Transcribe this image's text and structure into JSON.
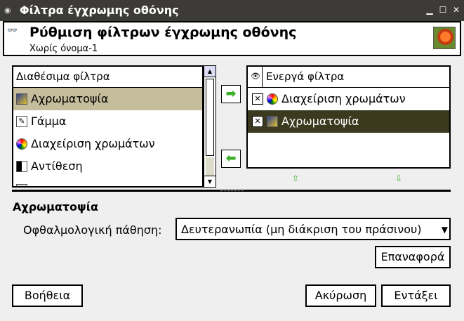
{
  "window": {
    "title": "Φίλτρα έγχρωμης οθόνης"
  },
  "header": {
    "title": "Ρύθμιση φίλτρων έγχρωμης οθόνης",
    "subtitle": "Χωρίς όνομα-1"
  },
  "available": {
    "heading": "Διαθέσιμα φίλτρα",
    "items": [
      {
        "label": "Αχρωματοψία",
        "icon": "color-filter-icon"
      },
      {
        "label": "Γάμμα",
        "icon": "gamma-icon"
      },
      {
        "label": "Διαχείριση χρωμάτων",
        "icon": "color-management-icon"
      },
      {
        "label": "Αντίθεση",
        "icon": "contrast-icon"
      }
    ]
  },
  "active": {
    "heading": "Ενεργά φίλτρα",
    "items": [
      {
        "label": "Διαχείριση χρωμάτων",
        "checked": true
      },
      {
        "label": "Αχρωματοψία",
        "checked": true
      }
    ]
  },
  "settings": {
    "section_title": "Αχρωματοψία",
    "condition_label": "Οφθαλμολογική πάθηση:",
    "condition_value": "Δευτερανωπία (μη διάκριση του πράσινου)",
    "reset_label": "Επαναφορά"
  },
  "buttons": {
    "help": "Βοήθεια",
    "cancel": "Ακύρωση",
    "ok": "Εντάξει"
  },
  "colors": {
    "selected_available": "#c5bd9b",
    "selected_active": "#3b3a1e",
    "arrow_green": "#3db02a"
  }
}
